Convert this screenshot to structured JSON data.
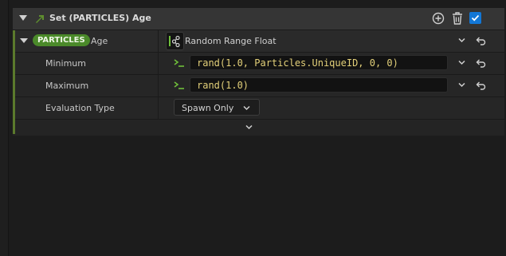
{
  "module": {
    "title": "Set (PARTICLES) Age",
    "enabled": true
  },
  "parameter": {
    "namespace_badge": "PARTICLES",
    "name": "Age",
    "dynamic_input": "Random Range Float"
  },
  "inputs": [
    {
      "label": "Minimum",
      "expression": "rand(1.0, Particles.UniqueID, 0, 0)"
    },
    {
      "label": "Maximum",
      "expression": "rand(1.0)"
    }
  ],
  "evaluation": {
    "label": "Evaluation Type",
    "value": "Spawn Only"
  },
  "icons": {
    "header_collapse": "triangle-down-icon",
    "module_type": "green-arrow-icon",
    "add": "plus-circle-icon",
    "delete": "trash-icon",
    "enable": "checkbox-checked-icon",
    "dynamic_input": "dynamic-input-icon",
    "expression": "prompt-icon",
    "dropdown": "chevron-down-icon",
    "reset": "reset-arrow-icon"
  },
  "colors": {
    "badge": "#4b8a2a",
    "expression_text": "#e3d079",
    "checkbox": "#1277d6",
    "accent_bar": "#5b7a2c"
  }
}
